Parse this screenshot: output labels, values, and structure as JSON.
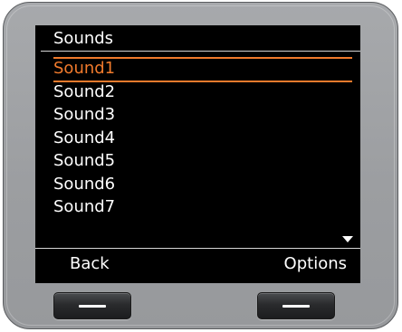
{
  "screen": {
    "title": "Sounds"
  },
  "menu": {
    "items": [
      {
        "label": "Sound1"
      },
      {
        "label": "Sound2"
      },
      {
        "label": "Sound3"
      },
      {
        "label": "Sound4"
      },
      {
        "label": "Sound5"
      },
      {
        "label": "Sound6"
      },
      {
        "label": "Sound7"
      }
    ],
    "selected_index": 0,
    "highlight_color": "#f07a2c",
    "has_more_below": true
  },
  "softkeys": {
    "left_label": "Back",
    "right_label": "Options"
  },
  "icons": {
    "scroll": "scroll-down-arrow-icon",
    "softkey": "softkey-dash-icon"
  }
}
